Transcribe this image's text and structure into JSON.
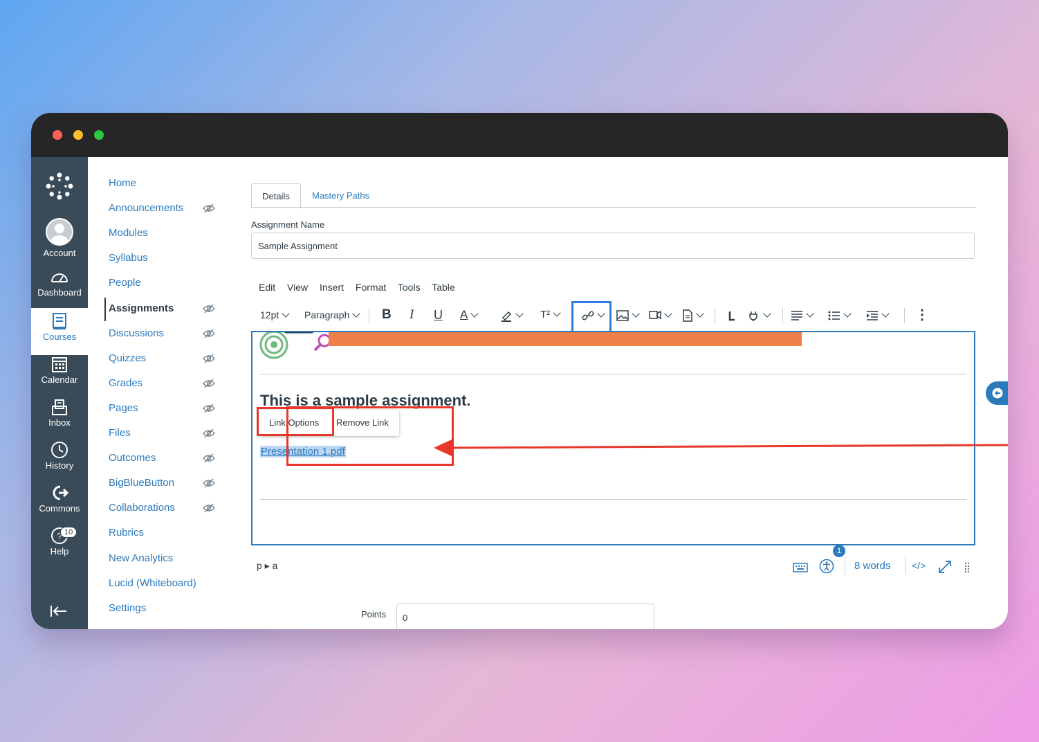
{
  "global_nav": {
    "items": [
      {
        "label": "Account",
        "icon": "avatar-icon"
      },
      {
        "label": "Dashboard",
        "icon": "dashboard-icon"
      },
      {
        "label": "Courses",
        "icon": "courses-icon"
      },
      {
        "label": "Calendar",
        "icon": "calendar-icon"
      },
      {
        "label": "Inbox",
        "icon": "inbox-icon"
      },
      {
        "label": "History",
        "icon": "history-icon"
      },
      {
        "label": "Commons",
        "icon": "commons-icon"
      },
      {
        "label": "Help",
        "icon": "help-icon"
      }
    ],
    "help_badge": "10",
    "active": "Courses"
  },
  "course_nav": {
    "items": [
      {
        "label": "Home"
      },
      {
        "label": "Announcements",
        "hidden": true
      },
      {
        "label": "Modules"
      },
      {
        "label": "Syllabus"
      },
      {
        "label": "People"
      },
      {
        "label": "Assignments",
        "hidden": true
      },
      {
        "label": "Discussions",
        "hidden": true
      },
      {
        "label": "Quizzes",
        "hidden": true
      },
      {
        "label": "Grades",
        "hidden": true
      },
      {
        "label": "Pages",
        "hidden": true
      },
      {
        "label": "Files",
        "hidden": true
      },
      {
        "label": "Outcomes",
        "hidden": true
      },
      {
        "label": "BigBlueButton",
        "hidden": true
      },
      {
        "label": "Collaborations",
        "hidden": true
      },
      {
        "label": "Rubrics"
      },
      {
        "label": "New Analytics"
      },
      {
        "label": "Lucid (Whiteboard)"
      },
      {
        "label": "Settings"
      }
    ],
    "active": "Assignments"
  },
  "tabs": {
    "details": "Details",
    "mastery_paths": "Mastery Paths"
  },
  "assignment": {
    "name_label": "Assignment Name",
    "name_value": "Sample Assignment",
    "points_label": "Points",
    "points_value": "0"
  },
  "editor": {
    "menu": [
      "Edit",
      "View",
      "Insert",
      "Format",
      "Tools",
      "Table"
    ],
    "font_size": "12pt",
    "block_format": "Paragraph",
    "superscript_label": "T²",
    "heading": "This is a sample assignment.",
    "link_text": "Presentation 1.pdf",
    "popup": {
      "link_options": "Link Options",
      "remove_link": "Remove Link"
    },
    "status": {
      "path": "p ▸ a",
      "a11y_count": "1",
      "word_count": "8 words",
      "html_toggle": "</>"
    }
  },
  "colors": {
    "canvas_blue": "#2b7abc",
    "nav_bg": "#394b58",
    "annotation_red": "#e8372a",
    "annotation_blue": "#2f7be6",
    "banner_orange": "#f07f4a"
  }
}
